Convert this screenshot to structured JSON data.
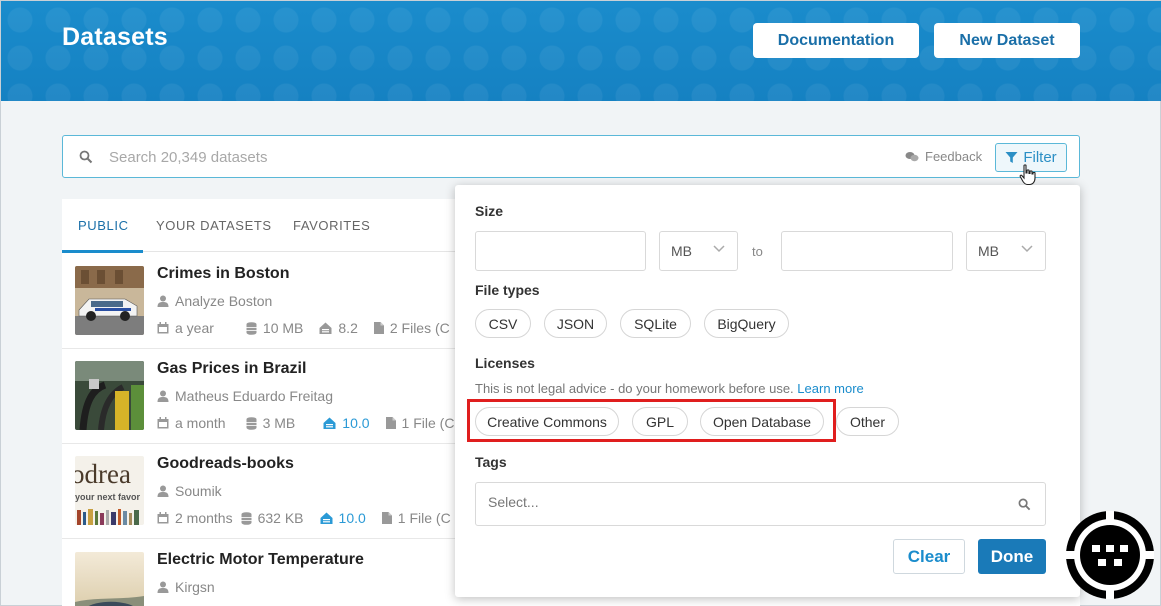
{
  "header": {
    "title": "Datasets",
    "documentation_label": "Documentation",
    "new_dataset_label": "New Dataset"
  },
  "search": {
    "placeholder": "Search 20,349 datasets",
    "feedback_label": "Feedback",
    "filter_label": "Filter"
  },
  "tabs": [
    {
      "label": "PUBLIC",
      "active": true
    },
    {
      "label": "YOUR DATASETS",
      "active": false
    },
    {
      "label": "FAVORITES",
      "active": false
    }
  ],
  "datasets": [
    {
      "title": "Crimes in Boston",
      "owner": "Analyze Boston",
      "updated": "a year",
      "size": "10 MB",
      "usability": "8.2",
      "files": "2 Files (C"
    },
    {
      "title": "Gas Prices in Brazil",
      "owner": "Matheus Eduardo Freitag",
      "updated": "a month",
      "size": "3 MB",
      "usability": "10.0",
      "files": "1 File (C"
    },
    {
      "title": "Goodreads-books",
      "owner": "Soumik",
      "updated": "2 months",
      "size": "632 KB",
      "usability": "10.0",
      "files": "1 File (C",
      "thumb_text_1": "odrea",
      "thumb_text_2": "your next favor"
    },
    {
      "title": "Electric Motor Temperature",
      "owner": "Kirgsn"
    }
  ],
  "filter": {
    "size_label": "Size",
    "min_unit": "MB",
    "to_label": "to",
    "max_unit": "MB",
    "file_types_label": "File types",
    "file_types": [
      "CSV",
      "JSON",
      "SQLite",
      "BigQuery"
    ],
    "licenses_label": "Licenses",
    "licenses_advice": "This is not legal advice - do your homework before use.",
    "learn_more": "Learn more",
    "licenses": [
      "Creative Commons",
      "GPL",
      "Open Database",
      "Other"
    ],
    "tags_label": "Tags",
    "tags_placeholder": "Select...",
    "clear_label": "Clear",
    "done_label": "Done"
  },
  "colors": {
    "header_blue": "#1a8ccc",
    "accent_blue": "#1a8ccc",
    "done_blue": "#1a7ab8",
    "highlight_red": "#e01e1e"
  }
}
